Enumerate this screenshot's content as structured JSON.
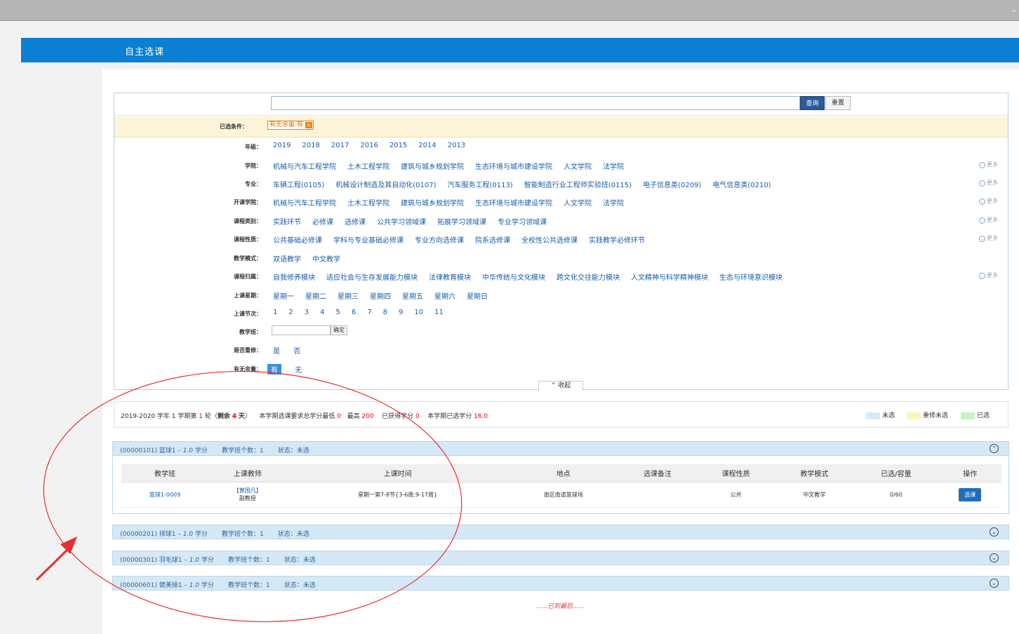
{
  "window": {
    "minimize": "–"
  },
  "header": {
    "title": "自主选课"
  },
  "search": {
    "placeholder": "",
    "query_label": "查询",
    "reset_label": "重置"
  },
  "conditions": {
    "label": "已选条件：",
    "tags": [
      {
        "text": "有无余量:有",
        "remove": "×"
      }
    ]
  },
  "filters": [
    {
      "label": "年级：",
      "options": [
        "2019",
        "2018",
        "2017",
        "2016",
        "2015",
        "2014",
        "2013"
      ],
      "more": ""
    },
    {
      "label": "学院：",
      "options": [
        "机械与汽车工程学院",
        "土木工程学院",
        "建筑与城乡规划学院",
        "生态环境与城市建设学院",
        "人文学院",
        "法学院"
      ],
      "more": "更多"
    },
    {
      "label": "专业：",
      "options": [
        "车辆工程(0105)",
        "机械设计制造及其自动化(0107)",
        "汽车服务工程(0113)",
        "智能制造行业工程师实验班(0115)",
        "电子信息类(0209)",
        "电气信息类(0210)"
      ],
      "more": "更多"
    },
    {
      "label": "开课学院：",
      "options": [
        "机械与汽车工程学院",
        "土木工程学院",
        "建筑与城乡规划学院",
        "生态环境与城市建设学院",
        "人文学院",
        "法学院"
      ],
      "more": "更多"
    },
    {
      "label": "课程类别：",
      "options": [
        "实践环节",
        "必修课",
        "选修课",
        "公共学习领域课",
        "拓展学习领域课",
        "专业学习领域课"
      ],
      "more": "更多"
    },
    {
      "label": "课程性质：",
      "options": [
        "公共基础必修课",
        "学科与专业基础必修课",
        "专业方向选修课",
        "院系选修课",
        "全校性公共选修课",
        "实践教学必修环节"
      ],
      "more": "更多"
    },
    {
      "label": "教学模式：",
      "options": [
        "双语教学",
        "中文教学"
      ],
      "more": ""
    },
    {
      "label": "课程归属：",
      "options": [
        "自我修养模块",
        "适应社会与生存发展能力模块",
        "法律教育模块",
        "中华传统与文化模块",
        "跨文化交往能力模块",
        "人文精神与科学精神模块",
        "生态与环境意识模块"
      ],
      "more": "更多"
    },
    {
      "label": "上课星期：",
      "options": [
        "星期一",
        "星期二",
        "星期三",
        "星期四",
        "星期五",
        "星期六",
        "星期日"
      ],
      "more": ""
    },
    {
      "label": "上课节次：",
      "options": [
        "1",
        "2",
        "3",
        "4",
        "5",
        "6",
        "7",
        "8",
        "9",
        "10",
        "11"
      ],
      "more": ""
    }
  ],
  "class_filter": {
    "label": "教学班：",
    "ok_label": "确定"
  },
  "retake_filter": {
    "label": "是否重修：",
    "options": [
      "是",
      "否"
    ]
  },
  "remaining_filter": {
    "label": "有无余量：",
    "options": [
      "有",
      "无"
    ],
    "selected": "有"
  },
  "collapse_label": "收起",
  "summary": {
    "prefix": "2019-2020 学年 1 学期第",
    "round": "1",
    "round_suffix": "轮（",
    "remain_label": "剩余",
    "remain_days": "4",
    "remain_unit": "天",
    "close": "）",
    "req_label": "本学期选课要求总学分最低",
    "min": "0",
    "max_label": "最高",
    "max": "200",
    "earned_label": "已获得学分",
    "earned": "0",
    "selected_label": "本学期已选学分",
    "selected": "16.0"
  },
  "legend": [
    {
      "label": "未选",
      "color": "#d7ebf8"
    },
    {
      "label": "重修未选",
      "color": "#fbf7b8"
    },
    {
      "label": "已选",
      "color": "#c8f2c8"
    }
  ],
  "courses": [
    {
      "code": "(00000101)",
      "name": "篮球1",
      "credits": "1.0",
      "classes": "1",
      "status": "未选",
      "expanded": true
    },
    {
      "code": "(00000201)",
      "name": "排球1",
      "credits": "1.0",
      "classes": "1",
      "status": "未选",
      "expanded": false
    },
    {
      "code": "(00000301)",
      "name": "羽毛球1",
      "credits": "1.0",
      "classes": "1",
      "status": "未选",
      "expanded": false
    },
    {
      "code": "(00000601)",
      "name": "健美操1",
      "credits": "1.0",
      "classes": "1",
      "status": "未选",
      "expanded": false
    }
  ],
  "course_labels": {
    "credit_unit": "学分",
    "classes_label": "教学班个数：",
    "status_label": "状态："
  },
  "table": {
    "headers": [
      "教学班",
      "上课教师",
      "上课时间",
      "地点",
      "选课备注",
      "课程性质",
      "教学模式",
      "已选/容量",
      "操作"
    ],
    "rows": [
      {
        "class": "篮球1-0009",
        "teacher": "【曾国凡】",
        "title": "副教授",
        "time": "星期一第7-8节{3-6周,9-17周}",
        "place": "南区南道篮球场",
        "note": "",
        "nature": "公共",
        "mode": "中文教学",
        "cap": "0/60",
        "action": "选课"
      }
    ]
  },
  "end_text": "......已到最后......"
}
